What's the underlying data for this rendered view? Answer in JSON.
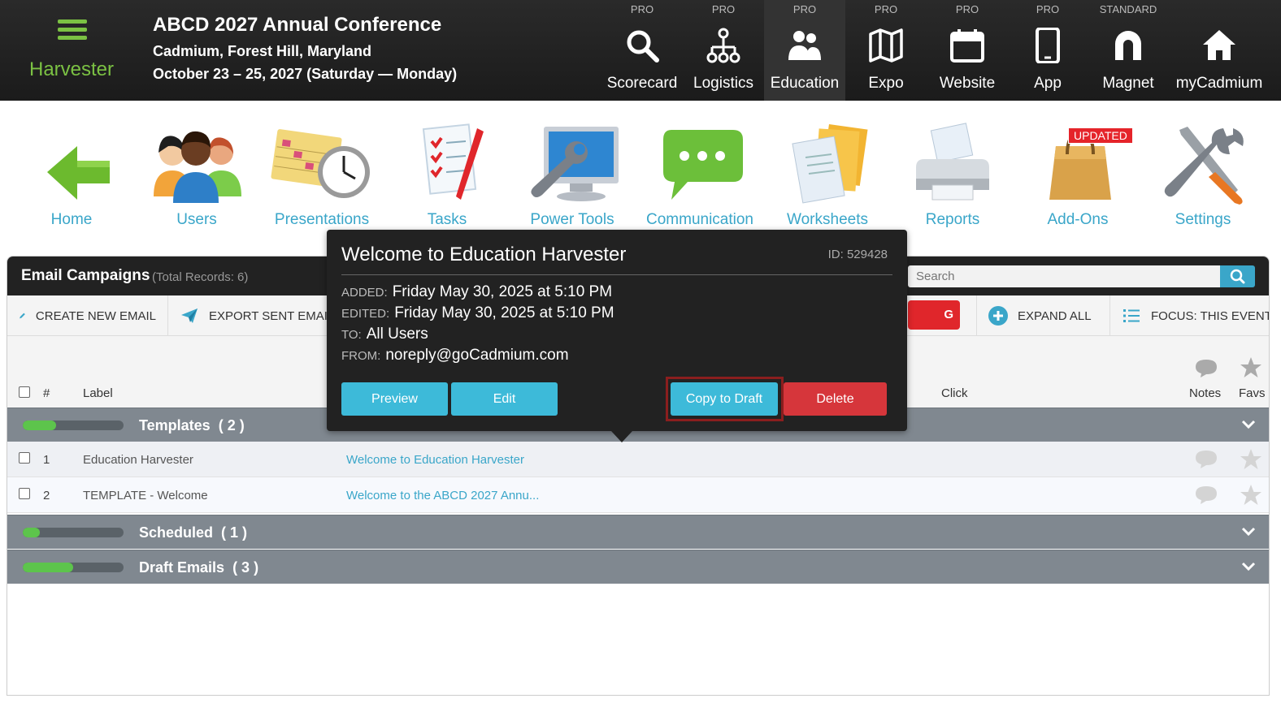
{
  "header": {
    "brand": "Harvester",
    "event_title": "ABCD 2027 Annual Conference",
    "event_location": "Cadmium, Forest Hill, Maryland",
    "event_dates": "October 23 – 25, 2027 (Saturday — Monday)",
    "modules": [
      {
        "tier": "PRO",
        "label": "Scorecard",
        "icon": "search-icon"
      },
      {
        "tier": "PRO",
        "label": "Logistics",
        "icon": "network-icon"
      },
      {
        "tier": "PRO",
        "label": "Education",
        "icon": "people-icon",
        "active": true
      },
      {
        "tier": "PRO",
        "label": "Expo",
        "icon": "map-icon"
      },
      {
        "tier": "PRO",
        "label": "Website",
        "icon": "calendar-icon"
      },
      {
        "tier": "PRO",
        "label": "App",
        "icon": "phone-icon"
      },
      {
        "tier": "STANDARD",
        "label": "Magnet",
        "icon": "magnet-icon"
      },
      {
        "tier": "",
        "label": "myCadmium",
        "icon": "home-icon"
      }
    ]
  },
  "nav": {
    "items": [
      {
        "label": "Home",
        "icon": "arrow-left-icon"
      },
      {
        "label": "Users",
        "icon": "users-icon"
      },
      {
        "label": "Presentations",
        "icon": "calendar-clock-icon"
      },
      {
        "label": "Tasks",
        "icon": "checklist-icon"
      },
      {
        "label": "Power Tools",
        "icon": "wrench-monitor-icon"
      },
      {
        "label": "Communication",
        "icon": "chat-bubble-icon"
      },
      {
        "label": "Worksheets",
        "icon": "folder-documents-icon"
      },
      {
        "label": "Reports",
        "icon": "printer-icon"
      },
      {
        "label": "Add-Ons",
        "icon": "shopping-bag-icon"
      },
      {
        "label": "Settings",
        "icon": "tools-icon"
      }
    ],
    "updated_badge": "UPDATED"
  },
  "panel": {
    "title": "Email Campaigns",
    "total_records": "(Total Records: 6)",
    "search_placeholder": "Search",
    "toolbar": {
      "create": "CREATE NEW EMAIL",
      "export": "EXPORT SENT EMAILS",
      "video": "G VIDEO",
      "expand": "EXPAND ALL",
      "focus": "FOCUS: THIS EVENT"
    },
    "columns": {
      "num": "#",
      "label": "Label",
      "click": "Click",
      "notes": "Notes",
      "favs": "Favs"
    },
    "groups": [
      {
        "name": "Templates",
        "count": "( 2 )",
        "progress": 0.33
      },
      {
        "name": "Scheduled",
        "count": "( 1 )",
        "progress": 0.17
      },
      {
        "name": "Draft Emails",
        "count": "( 3 )",
        "progress": 0.5
      }
    ],
    "rows": [
      {
        "num": "1",
        "label": "Education Harvester",
        "subject": "Welcome to Education Harvester"
      },
      {
        "num": "2",
        "label": "TEMPLATE - Welcome",
        "subject": "Welcome to the ABCD 2027 Annu..."
      }
    ]
  },
  "popover": {
    "title": "Welcome to Education Harvester",
    "id": "ID: 529428",
    "added_key": "ADDED:",
    "added": "Friday May 30, 2025 at 5:10 PM",
    "edited_key": "EDITED:",
    "edited": "Friday May 30, 2025 at 5:10 PM",
    "to_key": "TO:",
    "to": "All Users",
    "from_key": "FROM:",
    "from": "noreply@goCadmium.com",
    "buttons": {
      "preview": "Preview",
      "edit": "Edit",
      "copy": "Copy to Draft",
      "delete": "Delete"
    }
  },
  "colors": {
    "accent": "#3aa6c9",
    "brand_green": "#7bc143",
    "danger": "#d6363b",
    "header": "#1f1f1f"
  }
}
